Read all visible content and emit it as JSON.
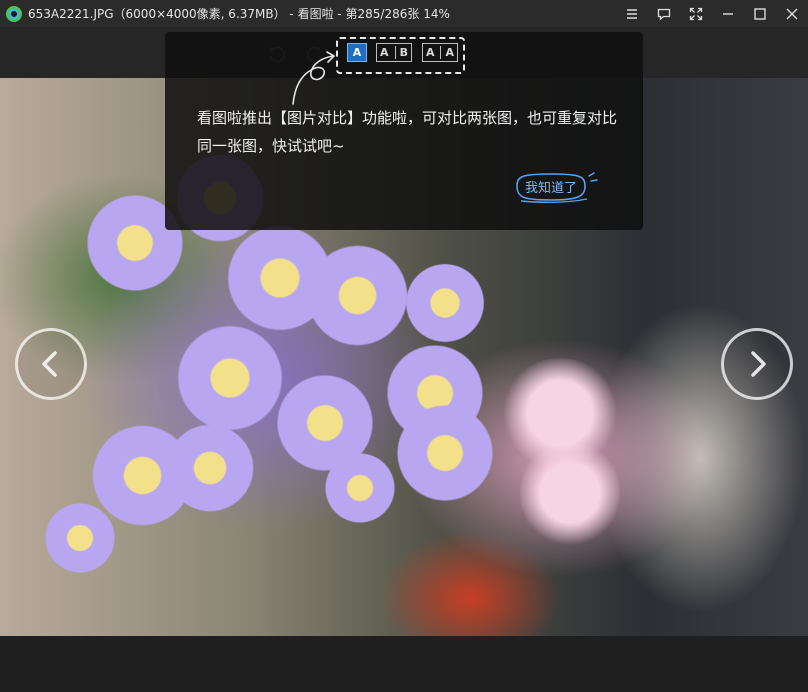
{
  "window": {
    "title": "653A2221.JPG（6000×4000像素, 6.37MB）  - 看图啦 - 第285/286张 14%",
    "controls": [
      "menu-icon",
      "feedback-icon",
      "fullscreen-icon",
      "minimize-icon",
      "maximize-icon",
      "close-icon"
    ]
  },
  "toolbar": {
    "tools": [
      "rotate-left-icon",
      "rotate-right-icon"
    ]
  },
  "compare_tip": {
    "modes": [
      {
        "id": "single",
        "letters": [
          "A"
        ],
        "selected": true
      },
      {
        "id": "two-images",
        "letters": [
          "A",
          "B"
        ],
        "selected": false
      },
      {
        "id": "same-image",
        "letters": [
          "A",
          "A"
        ],
        "selected": false
      }
    ],
    "message": "看图啦推出【图片对比】功能啦，可对比两张图，也可重复对比同一张图，快试试吧~",
    "dismiss_label": "我知道了"
  },
  "navigation": {
    "prev_icon": "chevron-left-icon",
    "next_icon": "chevron-right-icon"
  },
  "colors": {
    "accent": "#1e6fc4",
    "dismiss_text": "#7fb9ff"
  }
}
